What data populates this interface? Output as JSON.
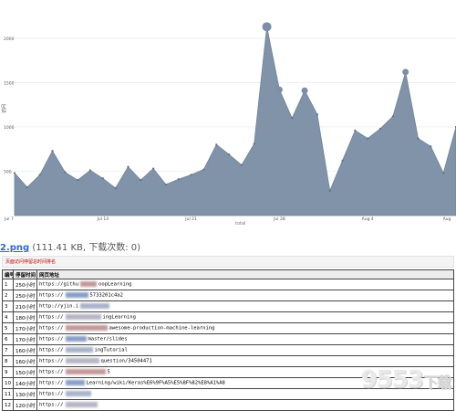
{
  "chart_data": {
    "type": "area",
    "xlabel": "total",
    "ylabel": "访问",
    "x_tick_labels": [
      "Jul 7",
      "Jul 14",
      "Jul 21",
      "Jul 28",
      "Aug 4",
      "Aug"
    ],
    "y_tick_labels": [
      "500",
      "1000",
      "1500",
      "2000"
    ],
    "ylim": [
      0,
      2350
    ],
    "x": [
      0,
      1,
      2,
      3,
      4,
      5,
      6,
      7,
      8,
      9,
      10,
      11,
      12,
      13,
      14,
      15,
      16,
      17,
      18,
      19,
      20,
      21,
      22,
      23,
      24,
      25,
      26,
      27,
      28,
      29,
      30,
      31,
      32,
      33,
      34,
      35
    ],
    "values": [
      480,
      320,
      460,
      730,
      490,
      400,
      510,
      420,
      310,
      550,
      400,
      530,
      350,
      410,
      460,
      520,
      800,
      690,
      570,
      810,
      2130,
      1420,
      1100,
      1410,
      1140,
      280,
      620,
      960,
      870,
      980,
      1120,
      1620,
      870,
      780,
      480,
      1000
    ],
    "grid": true,
    "color": "#8193a8"
  },
  "file_info": {
    "link": "2.png",
    "meta": "(111.41 KB, 下载次数: 0)"
  },
  "report": {
    "caption": "页面访问停留总时间排名",
    "columns": [
      "编号",
      "停留时间",
      "网页地址"
    ],
    "rows": [
      {
        "no": "1",
        "time": "250小时",
        "url_a": "https://githu",
        "url_b": "oopLearning"
      },
      {
        "no": "2",
        "time": "250小时",
        "url_a": "https://",
        "url_b": "5733201c4a2"
      },
      {
        "no": "3",
        "time": "210小时",
        "url_a": "http://yjin.i",
        "url_b": ""
      },
      {
        "no": "4",
        "time": "180小时",
        "url_a": "https://",
        "url_b": "ingLearning"
      },
      {
        "no": "5",
        "time": "170小时",
        "url_a": "https://",
        "url_b": "awesome-production-machine-learning"
      },
      {
        "no": "6",
        "time": "170小时",
        "url_a": "https://",
        "url_b": "master/slides"
      },
      {
        "no": "7",
        "time": "160小时",
        "url_a": "https://",
        "url_b": "ingTutorial"
      },
      {
        "no": "8",
        "time": "160小时",
        "url_a": "https://",
        "url_b": "question/34504471"
      },
      {
        "no": "9",
        "time": "150小时",
        "url_a": "https://",
        "url_b": "5"
      },
      {
        "no": "10",
        "time": "140小时",
        "url_a": "https://",
        "url_b": "Learning/wiki/Keras%E6%9F%A5%E5%8F%82%E8%A1%A8"
      },
      {
        "no": "11",
        "time": "130小时",
        "url_a": "https://",
        "url_b": ""
      },
      {
        "no": "12",
        "time": "120小时",
        "url_a": "https://",
        "url_b": ""
      }
    ]
  },
  "watermark": {
    "digits": "9553",
    "text": "下载"
  }
}
